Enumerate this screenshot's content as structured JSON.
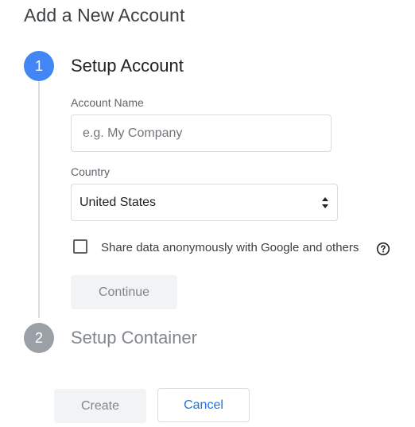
{
  "page": {
    "title": "Add a New Account"
  },
  "steps": [
    {
      "number": "1",
      "title": "Setup Account",
      "state": "active"
    },
    {
      "number": "2",
      "title": "Setup Container",
      "state": "inactive"
    }
  ],
  "account_name": {
    "label": "Account Name",
    "placeholder": "e.g. My Company",
    "value": ""
  },
  "country": {
    "label": "Country",
    "selected": "United States"
  },
  "share_data": {
    "label": "Share data anonymously with Google and others",
    "checked": false,
    "help_icon": "help-circle-icon"
  },
  "buttons": {
    "continue": "Continue",
    "create": "Create",
    "cancel": "Cancel"
  },
  "colors": {
    "accent": "#4285f4",
    "inactive_step": "#9aa0a6",
    "link_blue": "#1a73e8",
    "disabled_bg": "#f1f3f4"
  }
}
